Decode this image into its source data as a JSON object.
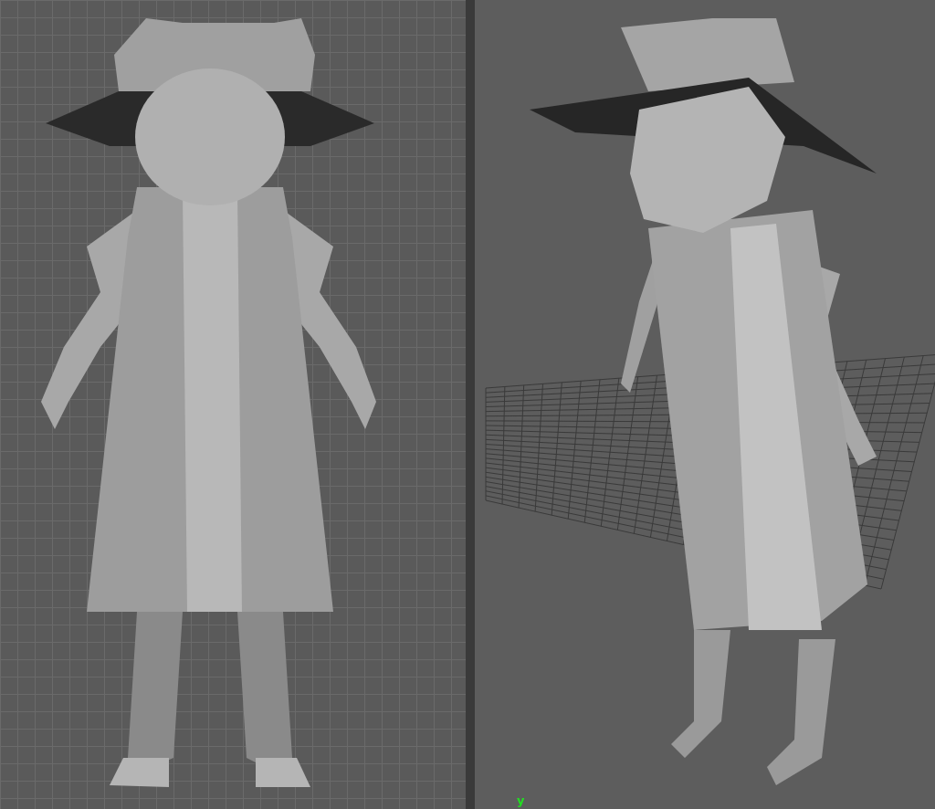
{
  "viewports": [
    {
      "kind": "orthographic"
    },
    {
      "kind": "perspective",
      "axis_label": "y"
    }
  ]
}
